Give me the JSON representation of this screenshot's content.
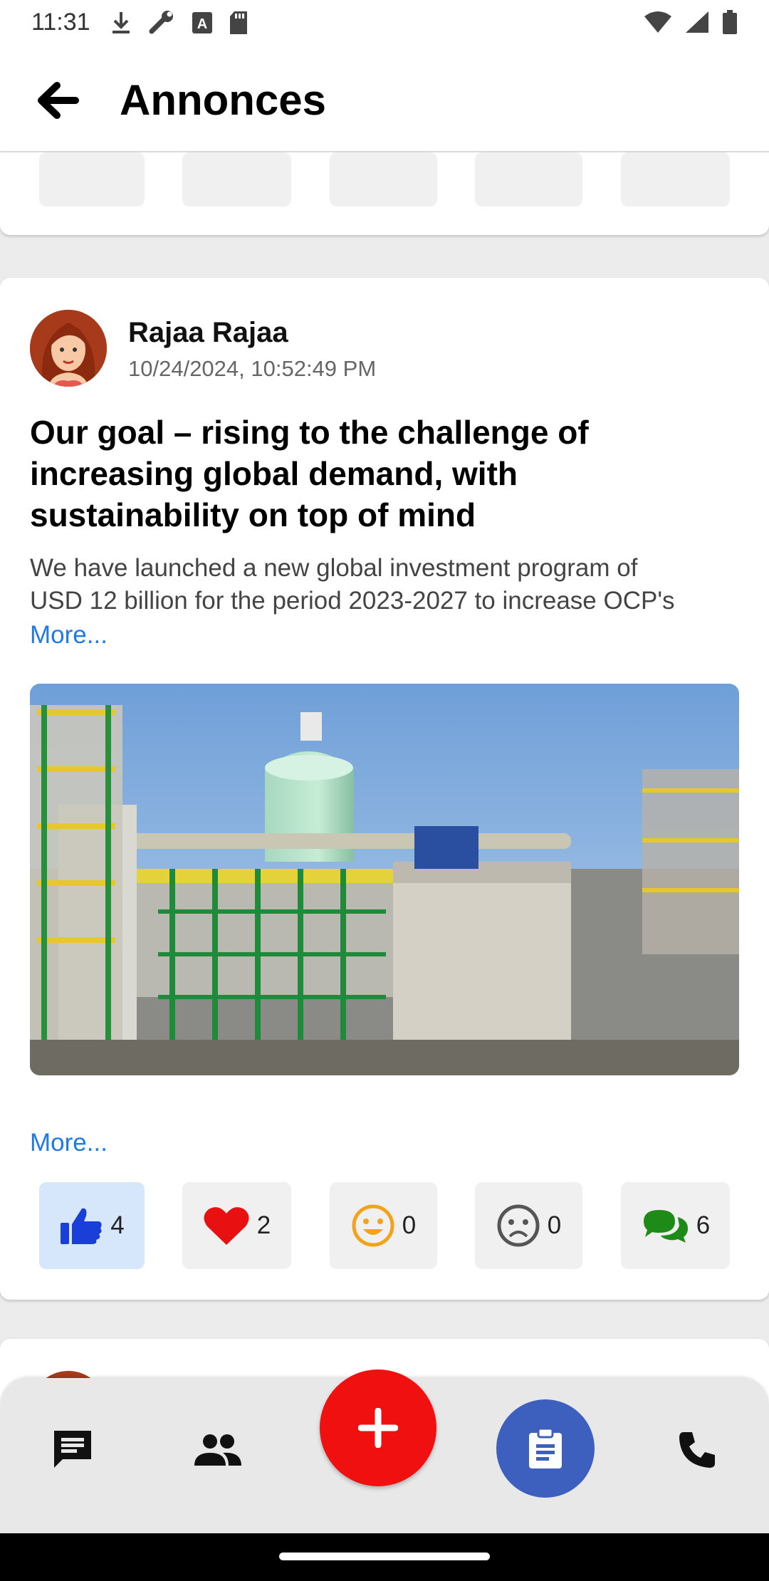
{
  "status_bar": {
    "time": "11:31",
    "left_icons": [
      "download-icon",
      "wrench-icon",
      "font-icon",
      "sd-card-icon"
    ],
    "right_icons": [
      "wifi-icon",
      "signal-icon",
      "battery-icon"
    ]
  },
  "app_bar": {
    "title": "Annonces",
    "back_icon": "arrow-back-icon"
  },
  "post": {
    "author": "Rajaa Rajaa",
    "date": "10/24/2024, 10:52:49 PM",
    "title": "Our goal – rising to the challenge of increasing global demand, with sustainability on top of mind",
    "excerpt_line1": "We have launched a new global investment program of",
    "excerpt_line2": "USD 12 billion for the period 2023-2027 to increase OCP's",
    "more_label": "More...",
    "more_label_2": "More...",
    "image_icon": "industrial-plant-image",
    "reactions": [
      {
        "icon": "thumbs-up-icon",
        "count": "4",
        "active": true,
        "color": "#1a3fd8"
      },
      {
        "icon": "heart-icon",
        "count": "2",
        "active": false,
        "color": "#e81010"
      },
      {
        "icon": "smile-icon",
        "count": "0",
        "active": false,
        "color": "#f2a31b"
      },
      {
        "icon": "sad-icon",
        "count": "0",
        "active": false,
        "color": "#555555"
      },
      {
        "icon": "comments-icon",
        "count": "6",
        "active": false,
        "color": "#1e8b18"
      }
    ]
  },
  "bottom_nav": {
    "items": [
      "chat-icon",
      "people-icon",
      "add-icon",
      "clipboard-icon",
      "phone-icon"
    ],
    "fab_color": "#f01010",
    "active_color": "#3d5fbd"
  }
}
